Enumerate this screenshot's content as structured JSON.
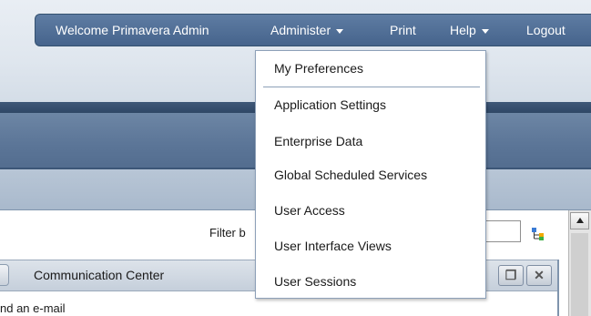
{
  "nav": {
    "welcome": "Welcome Primavera Admin",
    "administer": "Administer",
    "print": "Print",
    "help": "Help",
    "logout": "Logout"
  },
  "menu": {
    "items": [
      "My Preferences",
      "Application Settings",
      "Enterprise Data",
      "Global Scheduled Services",
      "User Access",
      "User Interface Views",
      "User Sessions"
    ]
  },
  "content": {
    "filter_label": "Filter b",
    "filter_value": ""
  },
  "panel": {
    "title": "Communication Center",
    "body_text": "nd an e-mail",
    "restore_glyph": "❐",
    "close_glyph": "✕"
  },
  "colors": {
    "nav_bar": "#46648c",
    "menu_border": "#8da0b8",
    "band_dark": "#2f4766",
    "band_mid": "#5b7597"
  },
  "icons": [
    "caret-down-icon",
    "tree-icon",
    "restore-icon",
    "close-icon",
    "scroll-up-icon"
  ]
}
